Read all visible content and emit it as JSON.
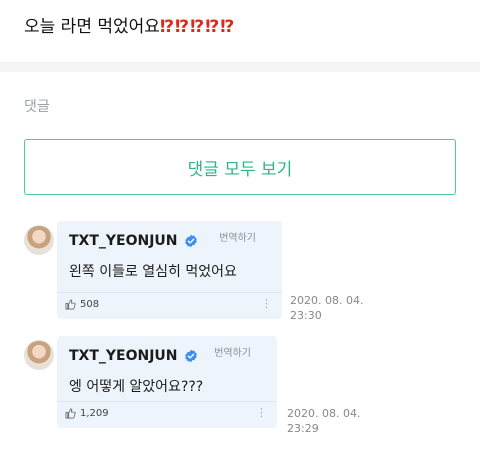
{
  "post": {
    "title_text": "오늘 라면 먹었어요",
    "title_marks": "⁉⁉⁉⁉⁉"
  },
  "comments_section": {
    "label": "댓글",
    "view_all_label": "댓글 모두 보기"
  },
  "comments": [
    {
      "author": "TXT_YEONJUN",
      "translate_label": "번역하기",
      "text": "왼쪽 이들로 열심히 먹었어요",
      "likes": "508",
      "date": "2020. 08. 04.",
      "time": "23:30"
    },
    {
      "author": "TXT_YEONJUN",
      "translate_label": "번역하기",
      "text": "엥 어떻게 알았어요???",
      "likes": "1,209",
      "date": "2020. 08. 04.",
      "time": "23:29"
    }
  ],
  "colors": {
    "accent": "#2cb58a",
    "accent_border": "#4ec9a3",
    "bubble": "#eef4fb",
    "verified": "#3b8ff0",
    "title_marks": "#d92a1c"
  },
  "icons": {
    "verified": "verified-badge-icon",
    "like": "thumbs-up-icon",
    "more": "more-vertical-icon"
  }
}
